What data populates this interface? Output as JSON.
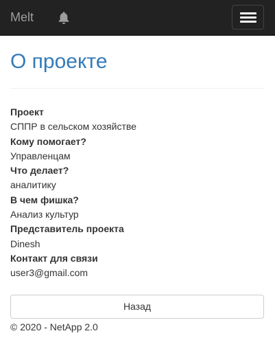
{
  "navbar": {
    "brand": "Melt",
    "bell_icon": "bell-icon",
    "menu_icon": "hamburger-menu-icon",
    "background": "#222222"
  },
  "page": {
    "title": "О проекте",
    "title_color": "#337ab7"
  },
  "details": [
    {
      "label": "Проект",
      "value": "СППР в сельском хозяйстве"
    },
    {
      "label": "Кому помогает?",
      "value": "Управленцам"
    },
    {
      "label": "Что делает?",
      "value": "аналитику"
    },
    {
      "label": "В чем фишка?",
      "value": "Анализ культур"
    },
    {
      "label": "Представитель проекта",
      "value": "Dinesh"
    },
    {
      "label": "Контакт для связи",
      "value": "user3@gmail.com"
    }
  ],
  "actions": {
    "back_label": "Назад"
  },
  "footer": {
    "text": "© 2020 - NetApp 2.0"
  }
}
